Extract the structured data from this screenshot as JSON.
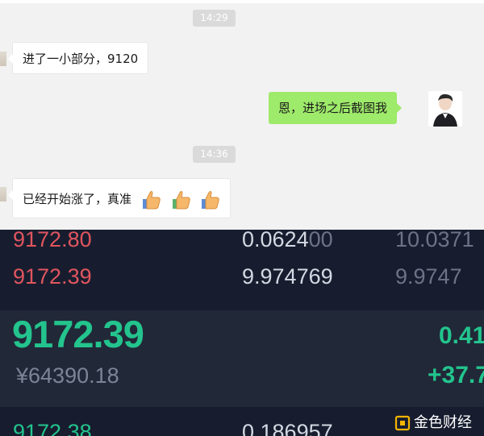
{
  "chat": {
    "messages": [
      {
        "time": "14:29"
      },
      {
        "text": "进了一小部分，9120"
      },
      {
        "text": "恩，进场之后截图我"
      },
      {
        "time": "14:36"
      },
      {
        "text": "已经开始涨了，真准"
      }
    ]
  },
  "orderbook": {
    "asks": [
      {
        "price": "9172.80",
        "amount_hi": "0.0624",
        "amount_lo": "00",
        "total": "10.0371"
      },
      {
        "price": "9172.39",
        "amount_hi": "9.974769",
        "amount_lo": "",
        "total": "9.9747"
      }
    ],
    "last": {
      "price": "9172.39",
      "cny": "¥64390.18",
      "percent": "0.41",
      "change": "+37.7"
    },
    "bids": [
      {
        "price": "9172.38",
        "amount": "0.186957"
      }
    ]
  },
  "watermark": {
    "text": "金色财经"
  },
  "colors": {
    "chat_bg": "#f2f2f2",
    "outgoing_bubble": "#9eea6a",
    "panel_bg": "#171d2e",
    "ask_red": "#e0555f",
    "up_green": "#23c48d"
  }
}
